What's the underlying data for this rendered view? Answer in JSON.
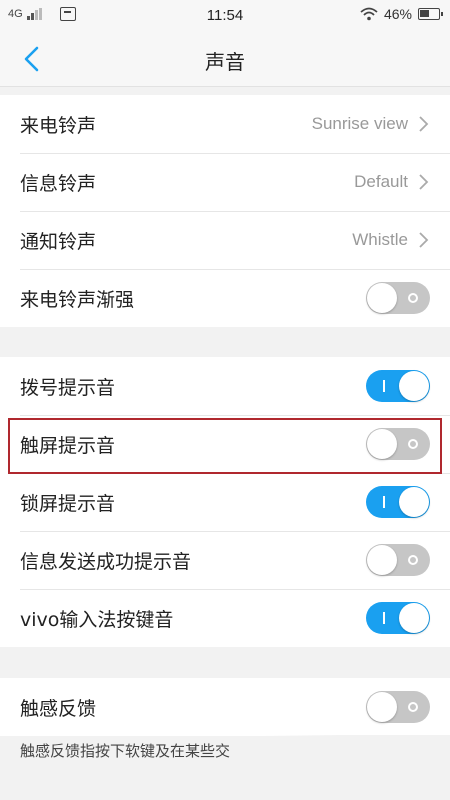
{
  "status_bar": {
    "network": "4G",
    "time": "11:54",
    "battery": "46%",
    "icons": [
      "signal-icon",
      "notification-icon",
      "wifi-icon",
      "battery-icon"
    ]
  },
  "header": {
    "title": "声音",
    "back_icon": "chevron-left-icon",
    "accent_color": "#1aa0f0"
  },
  "ringtones": [
    {
      "label": "来电铃声",
      "value": "Sunrise view"
    },
    {
      "label": "信息铃声",
      "value": "Default"
    },
    {
      "label": "通知铃声",
      "value": "Whistle"
    },
    {
      "label": "来电铃声渐强",
      "toggle": false
    }
  ],
  "tones": [
    {
      "label": "拨号提示音",
      "toggle": true
    },
    {
      "label": "触屏提示音",
      "toggle": false
    },
    {
      "label": "锁屏提示音",
      "toggle": true
    },
    {
      "label": "信息发送成功提示音",
      "toggle": false
    },
    {
      "label": "vivo输入法按键音",
      "toggle": true
    }
  ],
  "feedback": {
    "label": "触感反馈",
    "toggle": false,
    "description": "触感反馈指按下软键及在某些交"
  },
  "highlight_color": "#b0282e"
}
